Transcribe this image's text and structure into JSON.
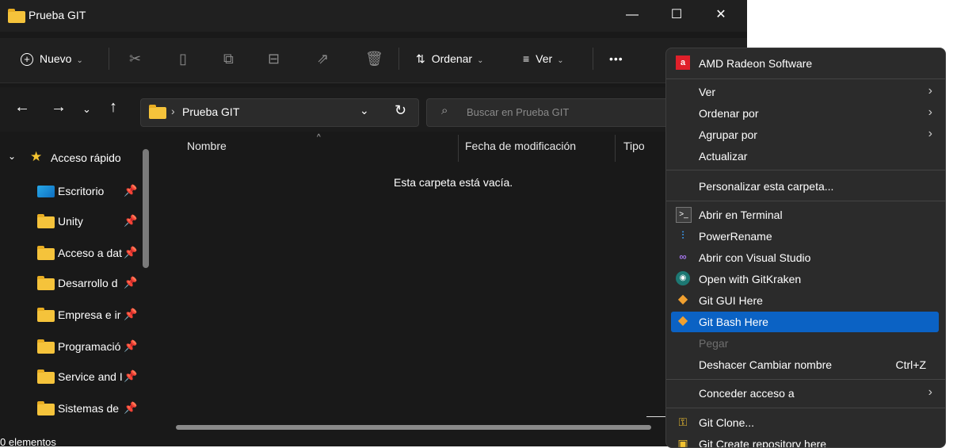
{
  "window": {
    "title": "Prueba GIT",
    "controls": {
      "minimize": "—",
      "maximize": "☐",
      "close": "✕"
    }
  },
  "toolbar": {
    "new_label": "Nuevo",
    "sort_label": "Ordenar",
    "view_label": "Ver",
    "more_label": "•••"
  },
  "navigation": {
    "breadcrumb": "Prueba GIT",
    "search_placeholder": "Buscar en Prueba GIT"
  },
  "sidebar": {
    "section_label": "Acceso rápido",
    "items": [
      {
        "label": "Escritorio"
      },
      {
        "label": "Unity"
      },
      {
        "label": "Acceso a dat"
      },
      {
        "label": "Desarrollo d"
      },
      {
        "label": "Empresa e ir"
      },
      {
        "label": "Programació"
      },
      {
        "label": "Service and I"
      },
      {
        "label": "Sistemas de"
      }
    ]
  },
  "content": {
    "columns": [
      "Nombre",
      "Fecha de modificación",
      "Tipo"
    ],
    "empty_message": "Esta carpeta está vacía."
  },
  "status": {
    "items_text": "0 elementos"
  },
  "context_menu": {
    "items": [
      {
        "label": "AMD Radeon Software",
        "icon": "amd-icon"
      },
      {
        "label": "Ver",
        "submenu": true
      },
      {
        "label": "Ordenar por",
        "submenu": true
      },
      {
        "label": "Agrupar por",
        "submenu": true
      },
      {
        "label": "Actualizar"
      },
      {
        "label": "Personalizar esta carpeta..."
      },
      {
        "label": "Abrir en Terminal",
        "icon": "terminal-icon"
      },
      {
        "label": "PowerRename",
        "icon": "powerrename-icon"
      },
      {
        "label": "Abrir con Visual Studio",
        "icon": "visual-studio-icon"
      },
      {
        "label": "Open with GitKraken",
        "icon": "gitkraken-icon"
      },
      {
        "label": "Git GUI Here",
        "icon": "git-icon"
      },
      {
        "label": "Git Bash Here",
        "icon": "git-icon",
        "selected": true
      },
      {
        "label": "Pegar",
        "disabled": true
      },
      {
        "label": "Deshacer Cambiar nombre",
        "shortcut": "Ctrl+Z"
      },
      {
        "label": "Conceder acceso a",
        "submenu": true
      },
      {
        "label": "Git Clone...",
        "icon": "git-clone-icon"
      },
      {
        "label": "Git Create repository here",
        "icon": "git-create-icon"
      }
    ]
  },
  "colors": {
    "accent": "#0b62c4",
    "folder": "#f5c33b",
    "background": "#191919",
    "menu": "#2b2b2b"
  }
}
